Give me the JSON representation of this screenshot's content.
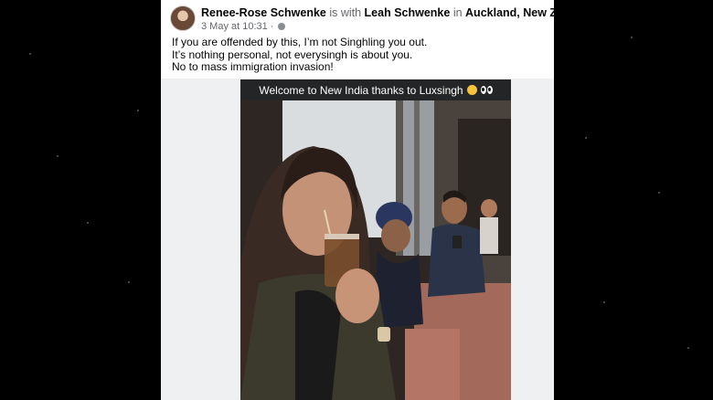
{
  "post": {
    "author": "Renee-Rose Schwenke",
    "with_word": " is with ",
    "tagged": "Leah Schwenke",
    "in_word": " in ",
    "location": "Auckland, New Zealand",
    "period": ".",
    "timestamp": "3 May at 10:31",
    "separator": "·",
    "privacy_icon": "globe-icon",
    "text_lines": [
      "If you are offended by this, I’m not Singhling you out.",
      "It’s nothing personal, not everysingh is about you.",
      "No to mass immigration invasion!"
    ]
  },
  "photo": {
    "caption": "Welcome to New India thanks to Luxsingh",
    "caption_icons": [
      "winking-tongue-face-emoji",
      "eyes-emoji"
    ]
  },
  "colors": {
    "page_background": "#000000",
    "card_background": "#ffffff",
    "caption_background": "#242526",
    "secondary_text": "#65676b"
  }
}
